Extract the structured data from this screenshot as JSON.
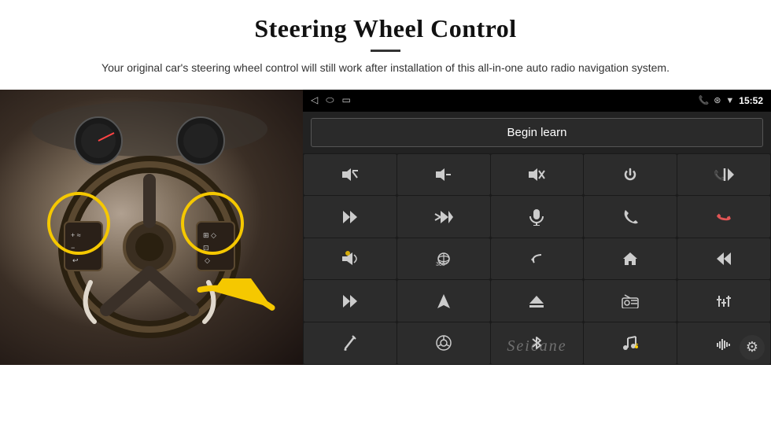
{
  "header": {
    "title": "Steering Wheel Control",
    "subtitle": "Your original car's steering wheel control will still work after installation of this all-in-one auto radio navigation system."
  },
  "android_screen": {
    "topbar": {
      "nav_icons": [
        "◁",
        "○",
        "□"
      ],
      "status_icons": [
        "📞",
        "⊛",
        "▼"
      ],
      "time": "15:52"
    },
    "begin_learn_label": "Begin learn",
    "controls": [
      {
        "id": "vol-up",
        "icon": "🔊+"
      },
      {
        "id": "vol-down",
        "icon": "🔉-"
      },
      {
        "id": "mute",
        "icon": "🔇"
      },
      {
        "id": "power",
        "icon": "⏻"
      },
      {
        "id": "prev-track-phone",
        "icon": "⏮📞"
      },
      {
        "id": "next-track",
        "icon": "⏭"
      },
      {
        "id": "ff-skip",
        "icon": "⏭⏭"
      },
      {
        "id": "mic",
        "icon": "🎤"
      },
      {
        "id": "phone",
        "icon": "📞"
      },
      {
        "id": "hang-up",
        "icon": "📵"
      },
      {
        "id": "speaker",
        "icon": "📢"
      },
      {
        "id": "360-cam",
        "icon": "360°"
      },
      {
        "id": "back",
        "icon": "↩"
      },
      {
        "id": "home",
        "icon": "⌂"
      },
      {
        "id": "rwd",
        "icon": "⏮⏮"
      },
      {
        "id": "fwd-skip2",
        "icon": "⏭"
      },
      {
        "id": "nav",
        "icon": "▲"
      },
      {
        "id": "eject",
        "icon": "⏏"
      },
      {
        "id": "radio",
        "icon": "📻"
      },
      {
        "id": "equalizer",
        "icon": "🎛"
      },
      {
        "id": "pen",
        "icon": "✏"
      },
      {
        "id": "steering",
        "icon": "🎡"
      },
      {
        "id": "bluetooth",
        "icon": "🔷"
      },
      {
        "id": "music-settings",
        "icon": "♫"
      },
      {
        "id": "bars",
        "icon": "📶"
      }
    ]
  },
  "watermark": "Seicane",
  "gear_icon": "⚙"
}
